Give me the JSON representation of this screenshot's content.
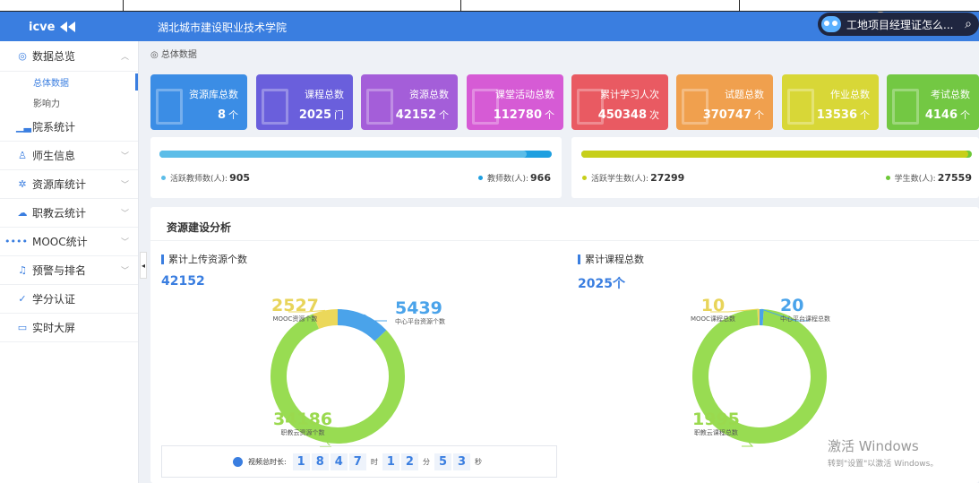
{
  "header": {
    "logo": "icve",
    "school": "湖北城市建设职业技术学院",
    "search_text": "工地项目经理证怎么..."
  },
  "sidebar": {
    "items": [
      {
        "label": "数据总览",
        "icon": "cube-icon"
      },
      {
        "label": "院系统计",
        "icon": "bar-chart-icon"
      },
      {
        "label": "师生信息",
        "icon": "user-icon"
      },
      {
        "label": "资源库统计",
        "icon": "network-icon"
      },
      {
        "label": "职教云统计",
        "icon": "cloud-icon"
      },
      {
        "label": "MOOC统计",
        "icon": "mooc-icon"
      },
      {
        "label": "预警与排名",
        "icon": "bell-icon"
      },
      {
        "label": "学分认证",
        "icon": "check-circle-icon"
      },
      {
        "label": "实时大屏",
        "icon": "monitor-icon"
      }
    ],
    "sub_items": [
      "总体数据",
      "影响力"
    ]
  },
  "breadcrumb": "总体数据",
  "cards": [
    {
      "title": "资源库总数",
      "value": "8",
      "unit": "个",
      "color": "#3b8de5"
    },
    {
      "title": "课程总数",
      "value": "2025",
      "unit": "门",
      "color": "#6a5fdc"
    },
    {
      "title": "资源总数",
      "value": "42152",
      "unit": "个",
      "color": "#a45ed9"
    },
    {
      "title": "课堂活动总数",
      "value": "112780",
      "unit": "个",
      "color": "#d65bd5"
    },
    {
      "title": "累计学习人次",
      "value": "450348",
      "unit": "次",
      "color": "#e95a62"
    },
    {
      "title": "试题总数",
      "value": "370747",
      "unit": "个",
      "color": "#f0a04e"
    },
    {
      "title": "作业总数",
      "value": "13536",
      "unit": "个",
      "color": "#d8d737"
    },
    {
      "title": "考试总数",
      "value": "4146",
      "unit": "个",
      "color": "#73c843"
    }
  ],
  "teachers": {
    "active_label": "活跃教师数(人):",
    "active_value": "905",
    "total_label": "教师数(人):",
    "total_value": "966",
    "bar_colors": [
      "#5cbde8",
      "#1e9fe0"
    ],
    "ratio": 0.937
  },
  "students": {
    "active_label": "活跃学生数(人):",
    "active_value": "27299",
    "total_label": "学生数(人):",
    "total_value": "27559",
    "bar_colors": [
      "#c7cf1a",
      "#6dc838"
    ],
    "ratio": 0.99
  },
  "analysis": {
    "title": "资源建设分析",
    "left": {
      "subtitle": "累计上传资源个数",
      "total": "42152",
      "labels": {
        "mooc_value": "2527",
        "mooc_text": "MOOC资源个数",
        "center_value": "5439",
        "center_text": "中心平台资源个数",
        "cloud_value": "34186",
        "cloud_text": "职教云资源个数"
      }
    },
    "right": {
      "subtitle": "累计课程总数",
      "total": "2025个",
      "labels": {
        "mooc_value": "10",
        "mooc_text": "MOOC课程总数",
        "center_value": "20",
        "center_text": "中心平台课程总数",
        "cloud_value": "1995",
        "cloud_text": "职教云课程总数"
      }
    }
  },
  "donuts": {
    "colors": {
      "cloud": "#98dc52",
      "center": "#4aa3ea",
      "mooc": "#ebd85a"
    },
    "left": {
      "cloud": 34186,
      "center": 5439,
      "mooc": 2527
    },
    "right": {
      "cloud": 1995,
      "center": 20,
      "mooc": 10
    }
  },
  "timer": {
    "label": "视频总时长:",
    "digits": [
      "1",
      "8",
      "4",
      "7",
      "1",
      "2",
      "5",
      "3"
    ],
    "units": [
      "时",
      "分",
      "秒"
    ]
  },
  "watermark": {
    "line1": "激活 Windows",
    "line2": "转到\"设置\"以激活 Windows。"
  }
}
